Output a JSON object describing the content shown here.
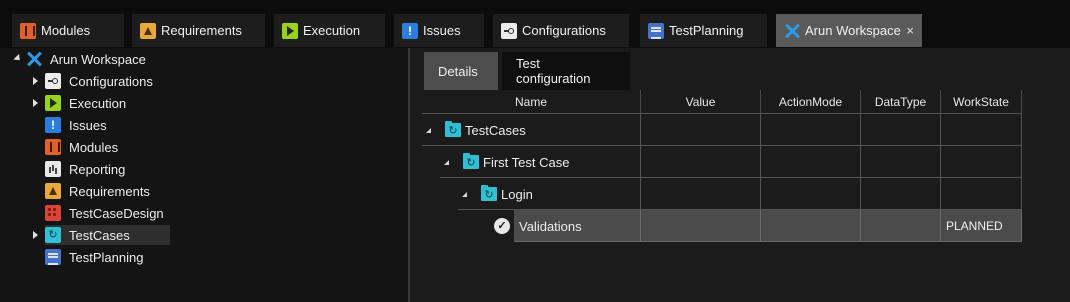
{
  "tabs": [
    {
      "label": "Modules",
      "icon": "modules-icon"
    },
    {
      "label": "Requirements",
      "icon": "requirements-icon"
    },
    {
      "label": "Execution",
      "icon": "execution-icon"
    },
    {
      "label": "Issues",
      "icon": "issues-icon"
    },
    {
      "label": "Configurations",
      "icon": "configurations-icon"
    },
    {
      "label": "TestPlanning",
      "icon": "testplanning-icon"
    },
    {
      "label": "Arun Workspace",
      "icon": "workspace-icon",
      "active": true,
      "close": "×"
    }
  ],
  "tree": {
    "root": "Arun Workspace",
    "items": [
      {
        "label": "Configurations",
        "icon": "configurations-icon",
        "expandable": true
      },
      {
        "label": "Execution",
        "icon": "execution-icon",
        "expandable": true
      },
      {
        "label": "Issues",
        "icon": "issues-icon",
        "expandable": false
      },
      {
        "label": "Modules",
        "icon": "modules-icon",
        "expandable": false
      },
      {
        "label": "Reporting",
        "icon": "reporting-icon",
        "expandable": false
      },
      {
        "label": "Requirements",
        "icon": "requirements-icon",
        "expandable": false
      },
      {
        "label": "TestCaseDesign",
        "icon": "testcasedesign-icon",
        "expandable": false
      },
      {
        "label": "TestCases",
        "icon": "testcases-icon",
        "expandable": true,
        "selected": true
      },
      {
        "label": "TestPlanning",
        "icon": "testplanning-icon",
        "expandable": false
      }
    ]
  },
  "panel": {
    "tabs": [
      "Details",
      "Test configuration"
    ],
    "columns": [
      "Name",
      "Value",
      "ActionMode",
      "DataType",
      "WorkState"
    ],
    "rows": [
      {
        "name": "TestCases",
        "icon": "testcases-folder-icon",
        "workstate": ""
      },
      {
        "name": "First Test Case",
        "icon": "testcase-folder-icon",
        "workstate": ""
      },
      {
        "name": "Login",
        "icon": "testcase-folder-icon",
        "workstate": ""
      },
      {
        "name": "Validations",
        "icon": "validations-icon",
        "workstate": "PLANNED",
        "selected": true
      }
    ]
  },
  "colors": {
    "background": "#141414",
    "active_tab": "#5a5a5a",
    "selected_row": "#4b4b4b",
    "workspace_accent": "#2a9be8"
  }
}
